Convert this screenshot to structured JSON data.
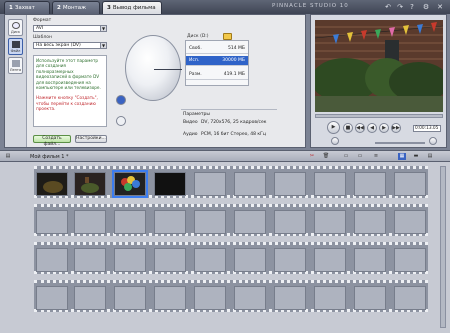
{
  "tabs": [
    {
      "num": "1",
      "label": "Захват"
    },
    {
      "num": "2",
      "label": "Монтаж"
    },
    {
      "num": "3",
      "label": "Вывод фильма"
    }
  ],
  "brand": "PINNACLE STUDIO 10",
  "tools": [
    {
      "label": "Диск"
    },
    {
      "label": "Файл"
    },
    {
      "label": "Лента"
    }
  ],
  "format": {
    "label": "Формат",
    "value": "AVI"
  },
  "template": {
    "label": "Шаблон",
    "value": "На весь экран (DV)"
  },
  "info_text": "Используйте этот параметр для создания полноразмерных видеозаписей в формате DV для воспроизведения на компьютере или телевизоре.",
  "hint_text": "Нажмите кнопку \"Создать\", чтобы перейти к созданию проекта.",
  "buttons": {
    "create": "Создать файл...",
    "settings": "Настройки..."
  },
  "disk": {
    "header": "Диск (D:)",
    "rows": [
      {
        "key": "Своб.",
        "value": "514 МБ"
      },
      {
        "key": "Исп.",
        "value": "30000 МБ"
      },
      {
        "key": "Разм.",
        "value": "419.1 МБ"
      }
    ]
  },
  "params": {
    "header": "Параметры",
    "rows": [
      {
        "key": "Видео",
        "value": "DV, 720x576, 25 кадров/сек"
      },
      {
        "key": "Аудио",
        "value": "PCM, 16 бит Стерео, 48 кГц"
      }
    ]
  },
  "player": {
    "timecode": "0:00:13.05"
  },
  "storyboard": {
    "title": "Мой фильм 1 *"
  },
  "colors": {
    "accent": "#2f63c8",
    "selection": "#3c7df0"
  }
}
